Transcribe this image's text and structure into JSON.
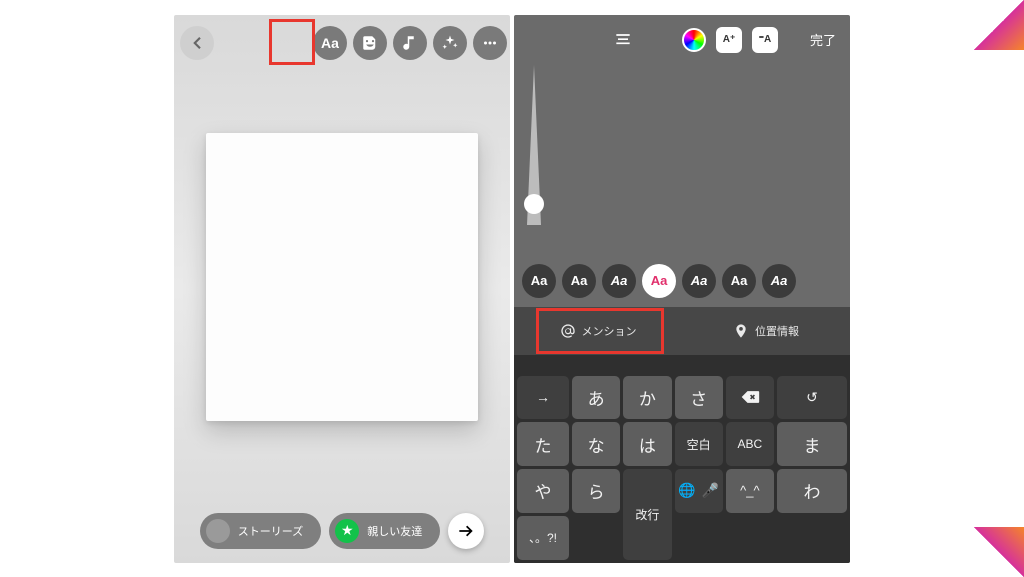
{
  "left": {
    "toolbar": {
      "text_icon_label": "Aa"
    },
    "bottom": {
      "stories_label": "ストーリーズ",
      "close_friends_label": "親しい友達",
      "close_friends_star": "★"
    }
  },
  "right": {
    "top": {
      "done_label": "完了",
      "anim_tool_label": "A⁺",
      "bg_tool_label": "⁼A"
    },
    "fonts": {
      "items": [
        "Aa",
        "Aa",
        "Aa",
        "Aa",
        "Aa",
        "Aa",
        "Aa"
      ],
      "selected_index": 3
    },
    "suggest": {
      "mention_label": "メンション",
      "location_label": "位置情報"
    },
    "keyboard": {
      "rows": [
        [
          "→",
          "あ",
          "か",
          "さ",
          "⌫"
        ],
        [
          "↺",
          "た",
          "な",
          "は",
          "空白"
        ],
        [
          "ABC",
          "ま",
          "や",
          "ら",
          "改行"
        ],
        [
          "",
          "^_^",
          "わ",
          "、。?!",
          ""
        ]
      ],
      "bottom_bar": [
        "🌐",
        "🎤"
      ]
    }
  }
}
